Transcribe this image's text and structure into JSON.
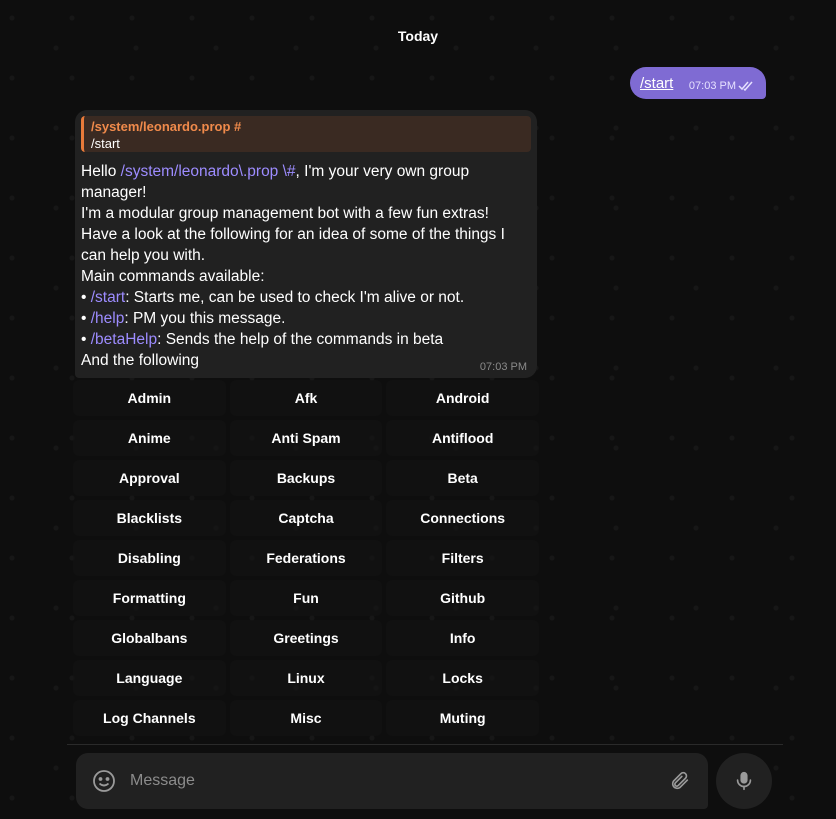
{
  "chat": {
    "day_separator": "Today",
    "outgoing": {
      "text": "/start",
      "time": "07:03 PM"
    },
    "incoming": {
      "reply_title": "/system/leonardo.prop #",
      "reply_text": "/start",
      "hello": "Hello ",
      "user_link": "/system/leonardo\\.prop \\#",
      "hello_rest": ", I'm your very own group manager!",
      "line2": "I'm a modular group management bot with a few fun extras!",
      "line3": "Have a look at the following for an idea of some of the things I can help you with.",
      "line4": "Main commands available:",
      "cmd_start": "/start",
      "cmd_start_desc": ": Starts me, can be used to check I'm alive or not.",
      "cmd_help": "/help",
      "cmd_help_desc": ": PM you this message.",
      "cmd_beta": "/betaHelp",
      "cmd_beta_desc": ": Sends the help of the commands in beta",
      "line_last": "And the following",
      "time": "07:03 PM"
    }
  },
  "keyboard": {
    "buttons": [
      "Admin",
      "Afk",
      "Android",
      "Anime",
      "Anti Spam",
      "Antiflood",
      "Approval",
      "Backups",
      "Beta",
      "Blacklists",
      "Captcha",
      "Connections",
      "Disabling",
      "Federations",
      "Filters",
      "Formatting",
      "Fun",
      "Github",
      "Globalbans",
      "Greetings",
      "Info",
      "Language",
      "Linux",
      "Locks",
      "Log Channels",
      "Misc",
      "Muting"
    ]
  },
  "composer": {
    "placeholder": "Message"
  },
  "icons": {
    "emoji": "emoji-icon",
    "attach": "paperclip-icon",
    "mic": "microphone-icon",
    "read": "double-check-icon"
  },
  "colors": {
    "accent": "#7f6bd3",
    "link": "#9d8cff",
    "reply_accent": "#e87a3a"
  }
}
